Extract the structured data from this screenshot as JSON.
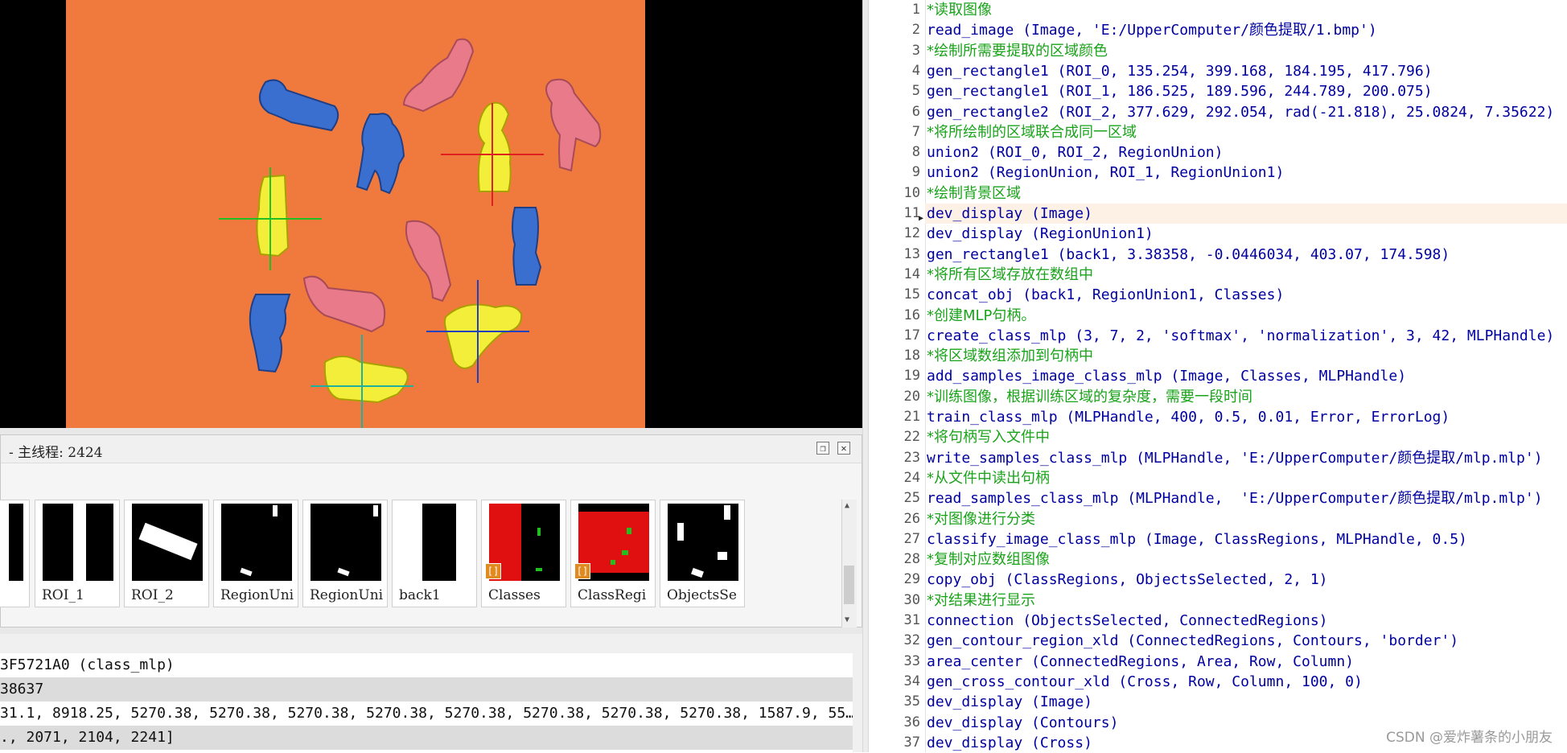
{
  "variable_window": {
    "title": "- 主线程: 2424",
    "thumbnails": [
      {
        "label": "ROI_1",
        "kind": "vbar"
      },
      {
        "label": "ROI_2",
        "kind": "rect-rot"
      },
      {
        "label": "RegionUni",
        "kind": "spots"
      },
      {
        "label": "RegionUni",
        "kind": "spots2"
      },
      {
        "label": "back1",
        "kind": "back"
      },
      {
        "label": "Classes",
        "kind": "classes",
        "badge": "[]"
      },
      {
        "label": "ClassRegi",
        "kind": "classregions",
        "badge": "[]"
      },
      {
        "label": "ObjectsSe",
        "kind": "objects"
      }
    ]
  },
  "data_rows": [
    "3F5721A0 (class_mlp)",
    "38637",
    "31.1, 8918.25, 5270.38, 5270.38, 5270.38, 5270.38, 5270.38, 5270.38, 5270.38, 5270.38, 1587.9, 55…",
    "., 2071, 2104, 2241]"
  ],
  "code": {
    "lines": [
      {
        "n": "1",
        "t": "*读取图像",
        "type": "comment"
      },
      {
        "n": "2",
        "t": "read_image (Image, 'E:/UpperComputer/颜色提取/1.bmp')",
        "type": "code"
      },
      {
        "n": "3",
        "t": "*绘制所需要提取的区域颜色",
        "type": "comment"
      },
      {
        "n": "4",
        "t": "gen_rectangle1 (ROI_0, 135.254, 399.168, 184.195, 417.796)",
        "type": "code"
      },
      {
        "n": "5",
        "t": "gen_rectangle1 (ROI_1, 186.525, 189.596, 244.789, 200.075)",
        "type": "code"
      },
      {
        "n": "6",
        "t": "gen_rectangle2 (ROI_2, 377.629, 292.054, rad(-21.818), 25.0824, 7.35622)",
        "type": "code"
      },
      {
        "n": "7",
        "t": "*将所绘制的区域联合成同一区域",
        "type": "comment"
      },
      {
        "n": "8",
        "t": "union2 (ROI_0, ROI_2, RegionUnion)",
        "type": "code"
      },
      {
        "n": "9",
        "t": "union2 (RegionUnion, ROI_1, RegionUnion1)",
        "type": "code"
      },
      {
        "n": "10",
        "t": "*绘制背景区域",
        "type": "comment"
      },
      {
        "n": "11",
        "t": "dev_display (Image)",
        "type": "code",
        "current": true
      },
      {
        "n": "12",
        "t": "dev_display (RegionUnion1)",
        "type": "code"
      },
      {
        "n": "13",
        "t": "gen_rectangle1 (back1, 3.38358, -0.0446034, 403.07, 174.598)",
        "type": "code"
      },
      {
        "n": "14",
        "t": "*将所有区域存放在数组中",
        "type": "comment"
      },
      {
        "n": "15",
        "t": "concat_obj (back1, RegionUnion1, Classes)",
        "type": "code"
      },
      {
        "n": "16",
        "t": "*创建MLP句柄。",
        "type": "comment"
      },
      {
        "n": "17",
        "t": "create_class_mlp (3, 7, 2, 'softmax', 'normalization', 3, 42, MLPHandle)",
        "type": "code"
      },
      {
        "n": "18",
        "t": "*将区域数组添加到句柄中",
        "type": "comment"
      },
      {
        "n": "19",
        "t": "add_samples_image_class_mlp (Image, Classes, MLPHandle)",
        "type": "code"
      },
      {
        "n": "20",
        "t": "*训练图像，根据训练区域的复杂度，需要一段时间",
        "type": "comment"
      },
      {
        "n": "21",
        "t": "train_class_mlp (MLPHandle, 400, 0.5, 0.01, Error, ErrorLog)",
        "type": "code"
      },
      {
        "n": "22",
        "t": "*将句柄写入文件中",
        "type": "comment"
      },
      {
        "n": "23",
        "t": "write_samples_class_mlp (MLPHandle, 'E:/UpperComputer/颜色提取/mlp.mlp')",
        "type": "code"
      },
      {
        "n": "24",
        "t": "*从文件中读出句柄",
        "type": "comment"
      },
      {
        "n": "25",
        "t": "read_samples_class_mlp (MLPHandle,  'E:/UpperComputer/颜色提取/mlp.mlp')",
        "type": "code"
      },
      {
        "n": "26",
        "t": "*对图像进行分类",
        "type": "comment"
      },
      {
        "n": "27",
        "t": "classify_image_class_mlp (Image, ClassRegions, MLPHandle, 0.5)",
        "type": "code"
      },
      {
        "n": "28",
        "t": "*复制对应数组图像",
        "type": "comment"
      },
      {
        "n": "29",
        "t": "copy_obj (ClassRegions, ObjectsSelected, 2, 1)",
        "type": "code"
      },
      {
        "n": "30",
        "t": "*对结果进行显示",
        "type": "comment"
      },
      {
        "n": "31",
        "t": "connection (ObjectsSelected, ConnectedRegions)",
        "type": "code"
      },
      {
        "n": "32",
        "t": "gen_contour_region_xld (ConnectedRegions, Contours, 'border')",
        "type": "code"
      },
      {
        "n": "33",
        "t": "area_center (ConnectedRegions, Area, Row, Column)",
        "type": "code"
      },
      {
        "n": "34",
        "t": "gen_cross_contour_xld (Cross, Row, Column, 100, 0)",
        "type": "code"
      },
      {
        "n": "35",
        "t": "dev_display (Image)",
        "type": "code"
      },
      {
        "n": "36",
        "t": "dev_display (Contours)",
        "type": "code"
      },
      {
        "n": "37",
        "t": "dev_display (Cross)",
        "type": "code"
      }
    ]
  },
  "watermark": "CSDN @爱炸薯条的小朋友",
  "colors": {
    "background_orange": "#f07a3e",
    "blue_piece": "#3a6fd0",
    "pink_piece": "#e87a8a",
    "yellow_piece": "#f2ee3a",
    "comment": "#1aa31a",
    "code": "#0000a0",
    "current_line_bg": "#fdf1e6"
  }
}
